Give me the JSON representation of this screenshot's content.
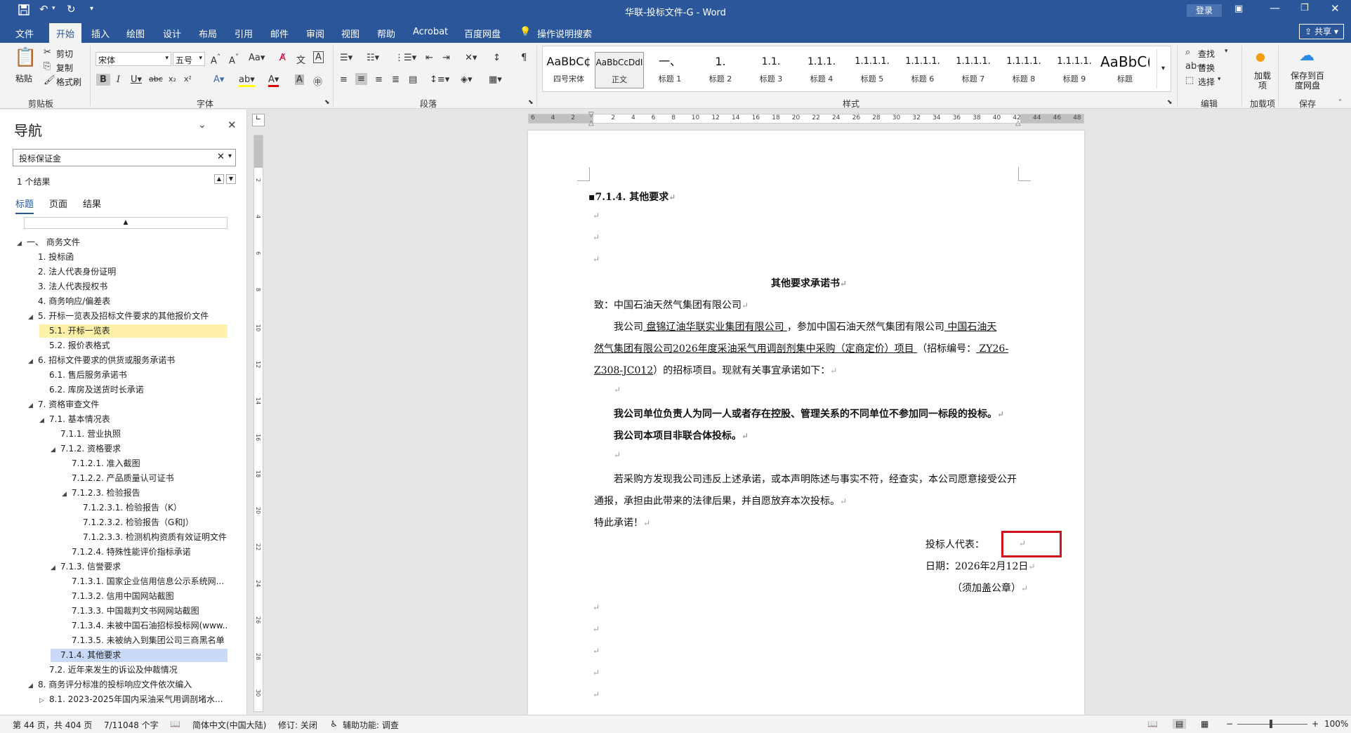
{
  "titlebar": {
    "title": "华联-投标文件-G  -  Word",
    "login_label": "登录",
    "save_icon": "save-icon",
    "undo_icon": "undo-icon",
    "redo_icon": "redo-icon"
  },
  "tabs": [
    "文件",
    "开始",
    "插入",
    "绘图",
    "设计",
    "布局",
    "引用",
    "邮件",
    "审阅",
    "视图",
    "帮助",
    "Acrobat",
    "百度网盘"
  ],
  "tellme": "操作说明搜索",
  "share_label": "共享",
  "clipboard": {
    "paste": "粘贴",
    "cut": "剪切",
    "copy": "复制",
    "format_painter": "格式刷",
    "label": "剪贴板"
  },
  "font": {
    "name": "宋体",
    "size": "五号",
    "label": "字体"
  },
  "paragraph": {
    "label": "段落"
  },
  "styles": {
    "label": "样式",
    "items": [
      {
        "preview": "AaBbC¢",
        "name": "四号宋体"
      },
      {
        "preview": "AaBbCcDdI",
        "name": "正文"
      },
      {
        "preview": "一、",
        "name": "标题 1"
      },
      {
        "preview": "1.",
        "name": "标题 2"
      },
      {
        "preview": "1.1.",
        "name": "标题 3"
      },
      {
        "preview": "1.1.1.",
        "name": "标题 4"
      },
      {
        "preview": "1.1.1.1.",
        "name": "标题 5"
      },
      {
        "preview": "1.1.1.1.",
        "name": "标题 6"
      },
      {
        "preview": "1.1.1.1.",
        "name": "标题 7"
      },
      {
        "preview": "1.1.1.1.",
        "name": "标题 8"
      },
      {
        "preview": "1.1.1.1.",
        "name": "标题 9"
      },
      {
        "preview": "AaBbC(",
        "name": "标题"
      }
    ]
  },
  "editing": {
    "find": "查找",
    "replace": "替换",
    "select": "选择",
    "label": "编辑"
  },
  "addins": {
    "name": "加载项",
    "label": "加载项"
  },
  "save_group": {
    "name": "保存到百度网盘",
    "label": "保存"
  },
  "nav": {
    "title": "导航",
    "search_value": "投标保证金",
    "result_count": "1 个结果",
    "tabs": [
      "标题",
      "页面",
      "结果"
    ],
    "items": [
      {
        "text": "一、 商务文件",
        "level": 0,
        "expander": "◢",
        "highlight": ""
      },
      {
        "text": "1. 投标函",
        "level": 1,
        "expander": "",
        "highlight": ""
      },
      {
        "text": "2. 法人代表身份证明",
        "level": 1,
        "expander": "",
        "highlight": ""
      },
      {
        "text": "3. 法人代表授权书",
        "level": 1,
        "expander": "",
        "highlight": ""
      },
      {
        "text": "4. 商务响应/偏差表",
        "level": 1,
        "expander": "",
        "highlight": ""
      },
      {
        "text": "5. 开标一览表及招标文件要求的其他报价文件",
        "level": 1,
        "expander": "◢",
        "highlight": ""
      },
      {
        "text": "5.1. 开标一览表",
        "level": 2,
        "expander": "",
        "highlight": "yellow"
      },
      {
        "text": "5.2. 报价表格式",
        "level": 2,
        "expander": "",
        "highlight": ""
      },
      {
        "text": "6. 招标文件要求的供货或服务承诺书",
        "level": 1,
        "expander": "◢",
        "highlight": ""
      },
      {
        "text": "6.1. 售后服务承诺书",
        "level": 2,
        "expander": "",
        "highlight": ""
      },
      {
        "text": "6.2. 库房及送货时长承诺",
        "level": 2,
        "expander": "",
        "highlight": ""
      },
      {
        "text": "7. 资格审查文件",
        "level": 1,
        "expander": "◢",
        "highlight": ""
      },
      {
        "text": "7.1. 基本情况表",
        "level": 2,
        "expander": "◢",
        "highlight": ""
      },
      {
        "text": "7.1.1. 营业执照",
        "level": 3,
        "expander": "",
        "highlight": ""
      },
      {
        "text": "7.1.2. 资格要求",
        "level": 3,
        "expander": "◢",
        "highlight": ""
      },
      {
        "text": "7.1.2.1. 准入截图",
        "level": 4,
        "expander": "",
        "highlight": ""
      },
      {
        "text": "7.1.2.2. 产品质量认可证书",
        "level": 4,
        "expander": "",
        "highlight": ""
      },
      {
        "text": "7.1.2.3. 检验报告",
        "level": 4,
        "expander": "◢",
        "highlight": ""
      },
      {
        "text": "7.1.2.3.1. 检验报告（K）",
        "level": 5,
        "expander": "",
        "highlight": ""
      },
      {
        "text": "7.1.2.3.2. 检验报告（G和J）",
        "level": 5,
        "expander": "",
        "highlight": ""
      },
      {
        "text": "7.1.2.3.3. 检测机构资质有效证明文件",
        "level": 5,
        "expander": "",
        "highlight": ""
      },
      {
        "text": "7.1.2.4. 特殊性能评价指标承诺",
        "level": 4,
        "expander": "",
        "highlight": ""
      },
      {
        "text": "7.1.3. 信誉要求",
        "level": 3,
        "expander": "◢",
        "highlight": ""
      },
      {
        "text": "7.1.3.1. 国家企业信用信息公示系统网...",
        "level": 4,
        "expander": "",
        "highlight": ""
      },
      {
        "text": "7.1.3.2. 信用中国网站截图",
        "level": 4,
        "expander": "",
        "highlight": ""
      },
      {
        "text": "7.1.3.3. 中国裁判文书网网站截图",
        "level": 4,
        "expander": "",
        "highlight": ""
      },
      {
        "text": "7.1.3.4. 未被中国石油招标投标网(www....",
        "level": 4,
        "expander": "",
        "highlight": ""
      },
      {
        "text": "7.1.3.5. 未被纳入到集团公司三商黑名单",
        "level": 4,
        "expander": "",
        "highlight": ""
      },
      {
        "text": "7.1.4. 其他要求",
        "level": 3,
        "expander": "",
        "highlight": "blue"
      },
      {
        "text": "7.2. 近年来发生的诉讼及仲裁情况",
        "level": 2,
        "expander": "",
        "highlight": ""
      },
      {
        "text": "8. 商务评分标准的投标响应文件依次编入",
        "level": 1,
        "expander": "◢",
        "highlight": ""
      },
      {
        "text": "8.1. 2023-2025年国内采油采气用调剖堵水...",
        "level": 2,
        "expander": "▷",
        "highlight": ""
      }
    ]
  },
  "ruler": {
    "ticks": [
      "6",
      "4",
      "2",
      "",
      "2",
      "4",
      "6",
      "8",
      "10",
      "12",
      "14",
      "16",
      "18",
      "20",
      "22",
      "24",
      "26",
      "28",
      "30",
      "32",
      "34",
      "36",
      "38",
      "40",
      "42",
      "44",
      "46",
      "48"
    ]
  },
  "vruler": {
    "ticks": [
      "2",
      "4",
      "6",
      "8",
      "10",
      "12",
      "14",
      "16",
      "18",
      "20",
      "22",
      "24",
      "26",
      "28",
      "30"
    ]
  },
  "doc": {
    "heading": "7.1.4. 其他要求",
    "title": "其他要求承诺书",
    "to": "致：中国石油天然气集团有限公司",
    "p1_a": "我公司",
    "p1_company": " 盘锦辽油华联实业集团有限公司 ",
    "p1_b": "，参加中国石油天然气集团有限公司",
    "p1_c": "   中国石油天",
    "p2_a": "然气集团有限公司2026年度采油采气用调剖剂集中采购（定商定价）项目   ",
    "p2_b": "（招标编号：",
    "p2_c": " ZY26-",
    "p3_a": "Z308-JC012",
    "p3_b": "）的招标项目。现就有关事宜承诺如下：",
    "bold1": "我公司单位负责人为同一人或者存在控股、管理关系的不同单位不参加同一标段的投标。",
    "bold2": "我公司本项目非联合体投标。",
    "p4": "若采购方发现我公司违反上述承诺，或本声明陈述与事实不符，经查实，本公司愿意接受公开",
    "p5": "通报，承担由此带来的法律后果，并自愿放弃本次投标。",
    "p6": "特此承诺！",
    "rep": "投标人代表：",
    "date": "日期：2026年2月12日",
    "seal": "（须加盖公章）",
    "para_mark": "↵"
  },
  "status": {
    "page": "第 44 页，共 404 页",
    "words": "7/11048 个字",
    "lang": "简体中文(中国大陆)",
    "track": "修订: 关闭",
    "access": "辅助功能: 调查",
    "zoom": "100%"
  },
  "colors": {
    "brand": "#2b579a",
    "highlight_red": "#d0141c"
  }
}
